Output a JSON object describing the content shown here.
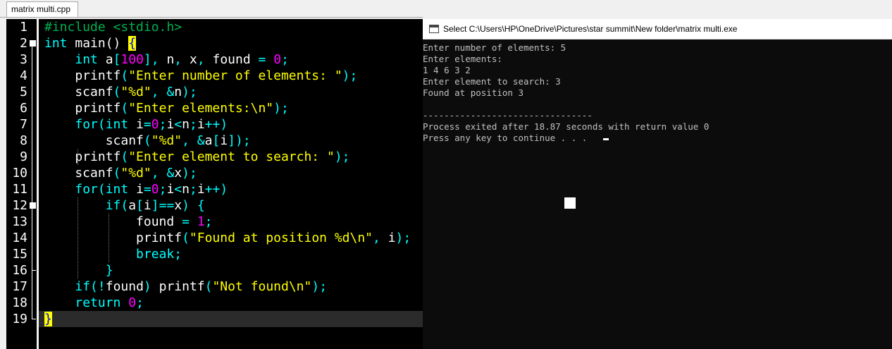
{
  "editor": {
    "tab_label": "matrix multi.cpp",
    "line_numbers": [
      "1",
      "2",
      "3",
      "4",
      "5",
      "6",
      "7",
      "8",
      "9",
      "10",
      "11",
      "12",
      "13",
      "14",
      "15",
      "16",
      "17",
      "18",
      "19"
    ],
    "lines": [
      [
        [
          "pp",
          "#include <stdio.h>"
        ]
      ],
      [
        [
          "kw",
          "int"
        ],
        [
          "id",
          " main() "
        ],
        [
          "bm",
          "{"
        ]
      ],
      [
        [
          "id",
          "    "
        ],
        [
          "kw",
          "int"
        ],
        [
          "id",
          " a"
        ],
        [
          "sym",
          "["
        ],
        [
          "num",
          "100"
        ],
        [
          "sym",
          "],"
        ],
        [
          "id",
          " n"
        ],
        [
          "sym",
          ","
        ],
        [
          "id",
          " x"
        ],
        [
          "sym",
          ","
        ],
        [
          "id",
          " found "
        ],
        [
          "sym",
          "="
        ],
        [
          "id",
          " "
        ],
        [
          "num",
          "0"
        ],
        [
          "sym",
          ";"
        ]
      ],
      [
        [
          "id",
          "    printf"
        ],
        [
          "sym",
          "("
        ],
        [
          "str",
          "\"Enter number of elements: \""
        ],
        [
          "sym",
          ");"
        ]
      ],
      [
        [
          "id",
          "    scanf"
        ],
        [
          "sym",
          "("
        ],
        [
          "str",
          "\"%d\""
        ],
        [
          "sym",
          ","
        ],
        [
          "id",
          " "
        ],
        [
          "sym",
          "&"
        ],
        [
          "id",
          "n"
        ],
        [
          "sym",
          ");"
        ]
      ],
      [
        [
          "id",
          "    printf"
        ],
        [
          "sym",
          "("
        ],
        [
          "str",
          "\"Enter elements:\\n\""
        ],
        [
          "sym",
          ");"
        ]
      ],
      [
        [
          "id",
          "    "
        ],
        [
          "kw",
          "for"
        ],
        [
          "sym",
          "("
        ],
        [
          "kw",
          "int"
        ],
        [
          "id",
          " i"
        ],
        [
          "sym",
          "="
        ],
        [
          "num",
          "0"
        ],
        [
          "sym",
          ";"
        ],
        [
          "id",
          "i"
        ],
        [
          "sym",
          "<"
        ],
        [
          "id",
          "n"
        ],
        [
          "sym",
          ";"
        ],
        [
          "id",
          "i"
        ],
        [
          "sym",
          "++)"
        ]
      ],
      [
        [
          "id",
          "        scanf"
        ],
        [
          "sym",
          "("
        ],
        [
          "str",
          "\"%d\""
        ],
        [
          "sym",
          ","
        ],
        [
          "id",
          " "
        ],
        [
          "sym",
          "&"
        ],
        [
          "id",
          "a"
        ],
        [
          "sym",
          "["
        ],
        [
          "id",
          "i"
        ],
        [
          "sym",
          "]);"
        ]
      ],
      [
        [
          "id",
          "    printf"
        ],
        [
          "sym",
          "("
        ],
        [
          "str",
          "\"Enter element to search: \""
        ],
        [
          "sym",
          ");"
        ]
      ],
      [
        [
          "id",
          "    scanf"
        ],
        [
          "sym",
          "("
        ],
        [
          "str",
          "\"%d\""
        ],
        [
          "sym",
          ","
        ],
        [
          "id",
          " "
        ],
        [
          "sym",
          "&"
        ],
        [
          "id",
          "x"
        ],
        [
          "sym",
          ");"
        ]
      ],
      [
        [
          "id",
          "    "
        ],
        [
          "kw",
          "for"
        ],
        [
          "sym",
          "("
        ],
        [
          "kw",
          "int"
        ],
        [
          "id",
          " i"
        ],
        [
          "sym",
          "="
        ],
        [
          "num",
          "0"
        ],
        [
          "sym",
          ";"
        ],
        [
          "id",
          "i"
        ],
        [
          "sym",
          "<"
        ],
        [
          "id",
          "n"
        ],
        [
          "sym",
          ";"
        ],
        [
          "id",
          "i"
        ],
        [
          "sym",
          "++)"
        ]
      ],
      [
        [
          "id",
          "        "
        ],
        [
          "kw",
          "if"
        ],
        [
          "sym",
          "("
        ],
        [
          "id",
          "a"
        ],
        [
          "sym",
          "["
        ],
        [
          "id",
          "i"
        ],
        [
          "sym",
          "]=="
        ],
        [
          "id",
          "x"
        ],
        [
          "sym",
          ")"
        ],
        [
          "id",
          " "
        ],
        [
          "sym",
          "{"
        ]
      ],
      [
        [
          "id",
          "            found "
        ],
        [
          "sym",
          "="
        ],
        [
          "id",
          " "
        ],
        [
          "num",
          "1"
        ],
        [
          "sym",
          ";"
        ]
      ],
      [
        [
          "id",
          "            printf"
        ],
        [
          "sym",
          "("
        ],
        [
          "str",
          "\"Found at position %d\\n\""
        ],
        [
          "sym",
          ","
        ],
        [
          "id",
          " i"
        ],
        [
          "sym",
          ");"
        ]
      ],
      [
        [
          "id",
          "            "
        ],
        [
          "kw",
          "break"
        ],
        [
          "sym",
          ";"
        ]
      ],
      [
        [
          "id",
          "        "
        ],
        [
          "sym",
          "}"
        ]
      ],
      [
        [
          "id",
          "    "
        ],
        [
          "kw",
          "if"
        ],
        [
          "sym",
          "(!"
        ],
        [
          "id",
          "found"
        ],
        [
          "sym",
          ")"
        ],
        [
          "id",
          " printf"
        ],
        [
          "sym",
          "("
        ],
        [
          "str",
          "\"Not found\\n\""
        ],
        [
          "sym",
          ");"
        ]
      ],
      [
        [
          "id",
          "    "
        ],
        [
          "kw",
          "return"
        ],
        [
          "id",
          " "
        ],
        [
          "num",
          "0"
        ],
        [
          "sym",
          ";"
        ]
      ],
      [
        [
          "bm",
          "}"
        ]
      ]
    ]
  },
  "console": {
    "title": "Select C:\\Users\\HP\\OneDrive\\Pictures\\star summit\\New folder\\matrix multi.exe",
    "output": [
      "Enter number of elements: 5",
      "Enter elements:",
      "1 4 6 3 2",
      "Enter element to search: 3",
      "Found at position 3",
      "",
      "--------------------------------",
      "Process exited after 18.87 seconds with return value 0",
      "Press any key to continue . . ."
    ]
  }
}
